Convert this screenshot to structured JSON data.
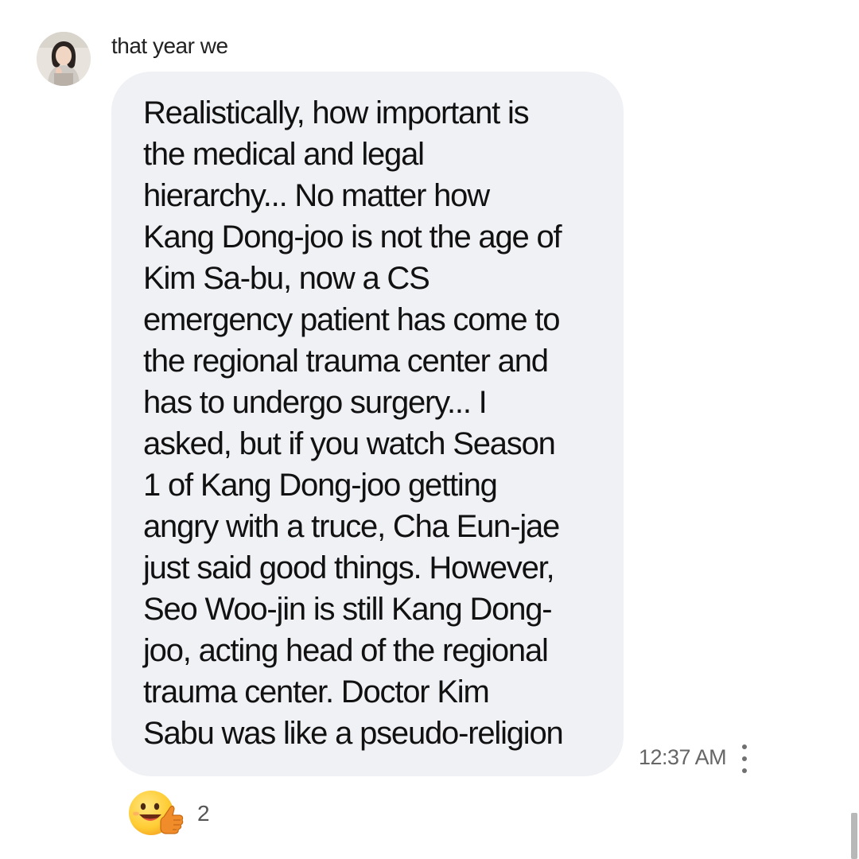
{
  "sender": {
    "name": "that year we"
  },
  "message": {
    "lines": [
      "Realistically, how important is",
      "the medical and legal",
      "hierarchy... No matter how",
      "Kang Dong-joo is not the age of",
      "Kim Sa-bu, now a CS",
      "emergency patient has come to",
      "the regional trauma center and",
      "has to undergo surgery... I",
      "asked, but if you watch Season",
      "1 of Kang Dong-joo getting",
      "angry with a truce, Cha Eun-jae",
      "just said good things. However,",
      "Seo Woo-jin is still Kang Dong-",
      "joo, acting head of the regional",
      "trauma center. Doctor Kim",
      "Sabu was like a pseudo-religion"
    ],
    "timestamp": "12:37 AM"
  },
  "reaction": {
    "emoji_icon": "thumbs-up-face-emoji",
    "count": "2"
  },
  "icons": {
    "more": "more-vertical-icon",
    "avatar": "profile-photo"
  },
  "colors": {
    "bubble": "#f0f1f5",
    "background": "#ffffff",
    "timestamp": "#666666"
  }
}
